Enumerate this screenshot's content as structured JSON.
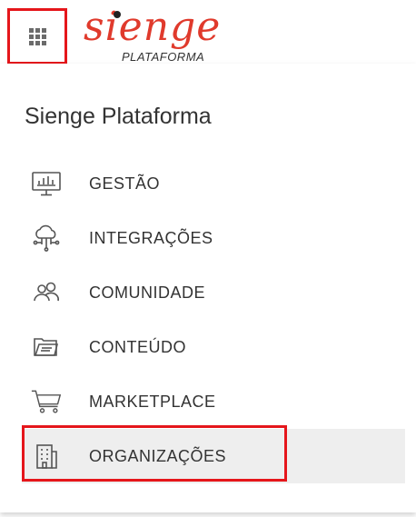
{
  "header": {
    "logo": {
      "wordmark": "sienge",
      "subtitle": "PLATAFORMA"
    }
  },
  "panel": {
    "title": "Sienge Plataforma",
    "items": [
      {
        "label": "GESTÃO",
        "icon": "monitor-chart-icon"
      },
      {
        "label": "INTEGRAÇÕES",
        "icon": "cloud-network-icon"
      },
      {
        "label": "COMUNIDADE",
        "icon": "users-icon"
      },
      {
        "label": "CONTEÚDO",
        "icon": "folder-document-icon"
      },
      {
        "label": "MARKETPLACE",
        "icon": "shopping-cart-icon"
      },
      {
        "label": "ORGANIZAÇÕES",
        "icon": "building-icon",
        "active": true
      }
    ]
  },
  "colors": {
    "highlight": "#e5161b",
    "logo": "#e03a2c",
    "text": "#333333",
    "icon": "#555555",
    "active_bg": "#eeeeee"
  }
}
